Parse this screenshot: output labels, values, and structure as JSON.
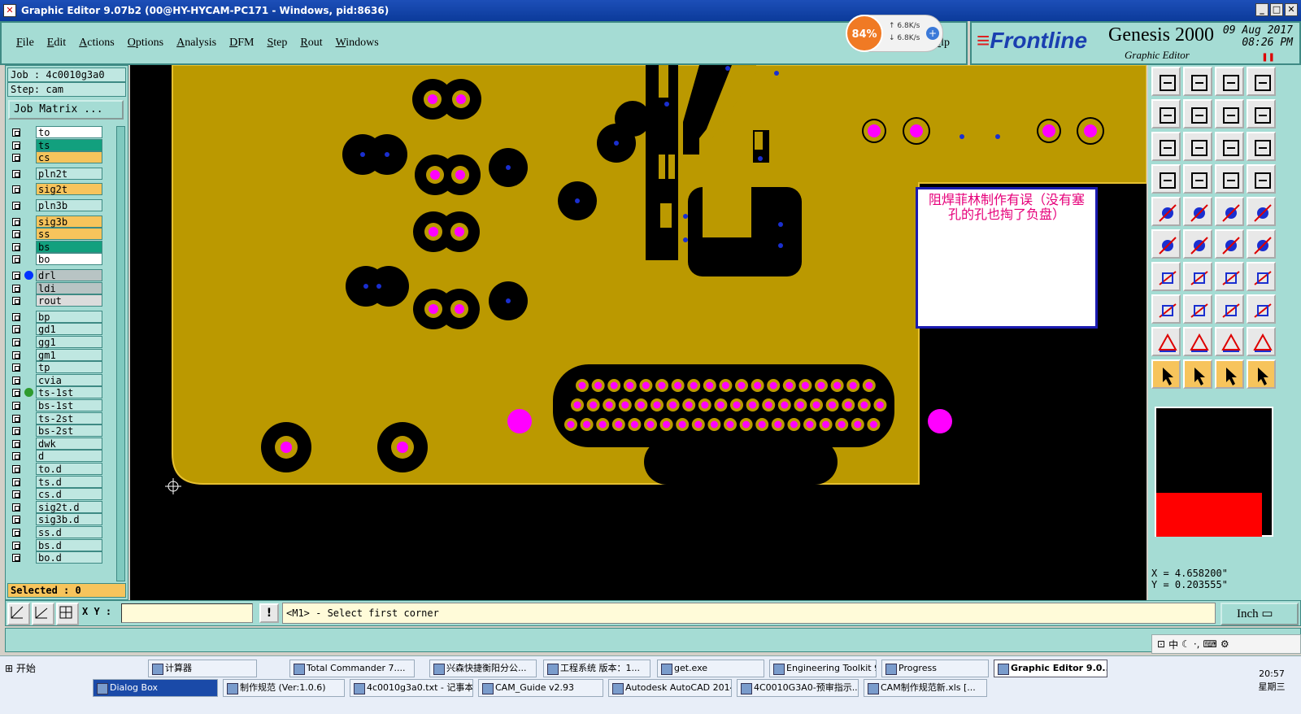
{
  "window": {
    "title": "Graphic Editor 9.07b2 (00@HY-HYCAM-PC171 - Windows, pid:8636)"
  },
  "menu": [
    "File",
    "Edit",
    "Actions",
    "Options",
    "Analysis",
    "DFM",
    "Step",
    "Rout",
    "Windows"
  ],
  "menu_tail": "elp",
  "network": {
    "percent": "84%",
    "up": "6.8K/s",
    "down": "6.8K/s"
  },
  "brand": {
    "logo": "Frontline",
    "product": "Genesis 2000",
    "subtitle": "Graphic Editor",
    "date": "09 Aug 2017",
    "time": "08:26 PM"
  },
  "job": {
    "job": "Job : 4c0010g3a0",
    "step": "Step: cam",
    "matrix": "Job Matrix ..."
  },
  "layers": [
    {
      "name": "to",
      "color": "#ffffff",
      "dot": ""
    },
    {
      "name": "ts",
      "color": "#12a07e",
      "dot": ""
    },
    {
      "name": "cs",
      "color": "#f7c45c",
      "dot": ""
    },
    {
      "name": "pln2t",
      "color": "#bfe7e1",
      "dot": ""
    },
    {
      "name": "sig2t",
      "color": "#f7c45c",
      "dot": ""
    },
    {
      "name": "pln3b",
      "color": "#bfe7e1",
      "dot": ""
    },
    {
      "name": "sig3b",
      "color": "#f7c45c",
      "dot": ""
    },
    {
      "name": "ss",
      "color": "#f7c45c",
      "dot": ""
    },
    {
      "name": "bs",
      "color": "#12a07e",
      "dot": ""
    },
    {
      "name": "bo",
      "color": "#ffffff",
      "dot": ""
    },
    {
      "name": "drl",
      "color": "#b8c4c4",
      "dot": "#0033ff"
    },
    {
      "name": "ldi",
      "color": "#b8c4c4",
      "dot": ""
    },
    {
      "name": "rout",
      "color": "#dcdcdc",
      "dot": ""
    },
    {
      "name": "bp",
      "color": "#bfe7e1",
      "dot": ""
    },
    {
      "name": "gd1",
      "color": "#bfe7e1",
      "dot": ""
    },
    {
      "name": "gg1",
      "color": "#bfe7e1",
      "dot": ""
    },
    {
      "name": "gm1",
      "color": "#bfe7e1",
      "dot": ""
    },
    {
      "name": "tp",
      "color": "#bfe7e1",
      "dot": ""
    },
    {
      "name": "cvia",
      "color": "#bfe7e1",
      "dot": ""
    },
    {
      "name": "ts-1st",
      "color": "#bfe7e1",
      "dot": "#2e9a2e"
    },
    {
      "name": "bs-1st",
      "color": "#bfe7e1",
      "dot": ""
    },
    {
      "name": "ts-2st",
      "color": "#bfe7e1",
      "dot": ""
    },
    {
      "name": "bs-2st",
      "color": "#bfe7e1",
      "dot": ""
    },
    {
      "name": "dwk",
      "color": "#bfe7e1",
      "dot": ""
    },
    {
      "name": "d",
      "color": "#bfe7e1",
      "dot": ""
    },
    {
      "name": "to.d",
      "color": "#bfe7e1",
      "dot": ""
    },
    {
      "name": "ts.d",
      "color": "#bfe7e1",
      "dot": ""
    },
    {
      "name": "cs.d",
      "color": "#bfe7e1",
      "dot": ""
    },
    {
      "name": "sig2t.d",
      "color": "#bfe7e1",
      "dot": ""
    },
    {
      "name": "sig3b.d",
      "color": "#bfe7e1",
      "dot": ""
    },
    {
      "name": "ss.d",
      "color": "#bfe7e1",
      "dot": ""
    },
    {
      "name": "bs.d",
      "color": "#bfe7e1",
      "dot": ""
    },
    {
      "name": "bo.d",
      "color": "#bfe7e1",
      "dot": ""
    }
  ],
  "selected": "Selected : 0",
  "note": "阻焊菲林制作有误（没有塞孔的孔也掏了负盘）",
  "coords": {
    "x": "X = 4.658200\"",
    "y": "Y = 0.203555\""
  },
  "cmd": {
    "xy_label": "X Y :",
    "prompt": "<M1> - Select first corner",
    "unit": "Inch"
  },
  "ime": "中",
  "taskbar": {
    "start": "开始",
    "row1": [
      "计算器",
      "Total Commander 7....",
      "兴森快捷衡阳分公...",
      "工程系统  版本：1...",
      "get.exe",
      "Engineering Toolkit 9...",
      "Progress",
      "Graphic Editor 9.0..."
    ],
    "row2": [
      "Dialog Box",
      "制作规范 (Ver:1.0.6)",
      "4c0010g3a0.txt - 记事本",
      "CAM_Guide v2.93",
      "Autodesk AutoCAD 2014...",
      "4C0010G3A0-预审指示....",
      "CAM制作规范新.xls  [..."
    ],
    "time": "20:57",
    "day": "星期三"
  },
  "colors": {
    "copper": "#bb9900",
    "pad": "#ff00ff",
    "drill": "#1a2fd0",
    "panel": "#a5dcd4"
  }
}
